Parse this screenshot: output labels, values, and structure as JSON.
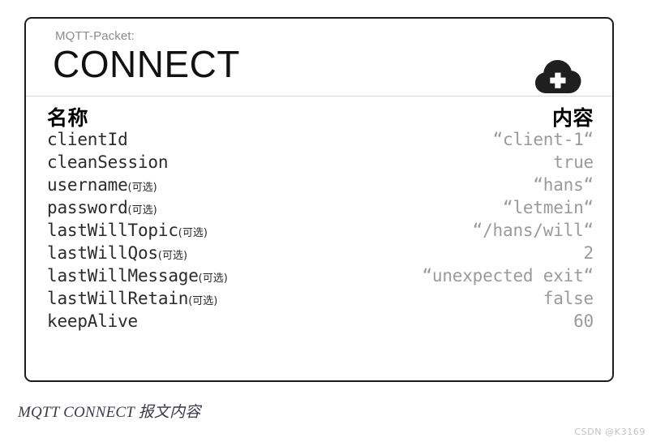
{
  "card": {
    "kicker": "MQTT-Packet:",
    "title": "CONNECT",
    "icon": "cloud-plus-icon",
    "border_color": "#1c1c1c",
    "divider_color": "#d8d8d8"
  },
  "table": {
    "headers": {
      "name": "名称",
      "value": "内容"
    },
    "optional_tag": "(可选)",
    "name_color": "#2b2b2b",
    "value_color": "#9a9a9a",
    "rows": [
      {
        "name": "clientId",
        "optional": "",
        "value": "“client-1“"
      },
      {
        "name": "cleanSession",
        "optional": "",
        "value": "true"
      },
      {
        "name": "username",
        "optional": "(可选)",
        "value": "“hans“"
      },
      {
        "name": "password",
        "optional": "(可选)",
        "value": "“letmein“"
      },
      {
        "name": "lastWillTopic",
        "optional": "(可选)",
        "value": "“/hans/will“"
      },
      {
        "name": "lastWillQos",
        "optional": "(可选)",
        "value": "2"
      },
      {
        "name": "lastWillMessage",
        "optional": "(可选)",
        "value": "“unexpected exit“"
      },
      {
        "name": "lastWillRetain",
        "optional": "(可选)",
        "value": "false"
      },
      {
        "name": "keepAlive",
        "optional": "",
        "value": "60"
      }
    ]
  },
  "caption": "MQTT CONNECT 报文内容",
  "watermark": "CSDN @K3169"
}
